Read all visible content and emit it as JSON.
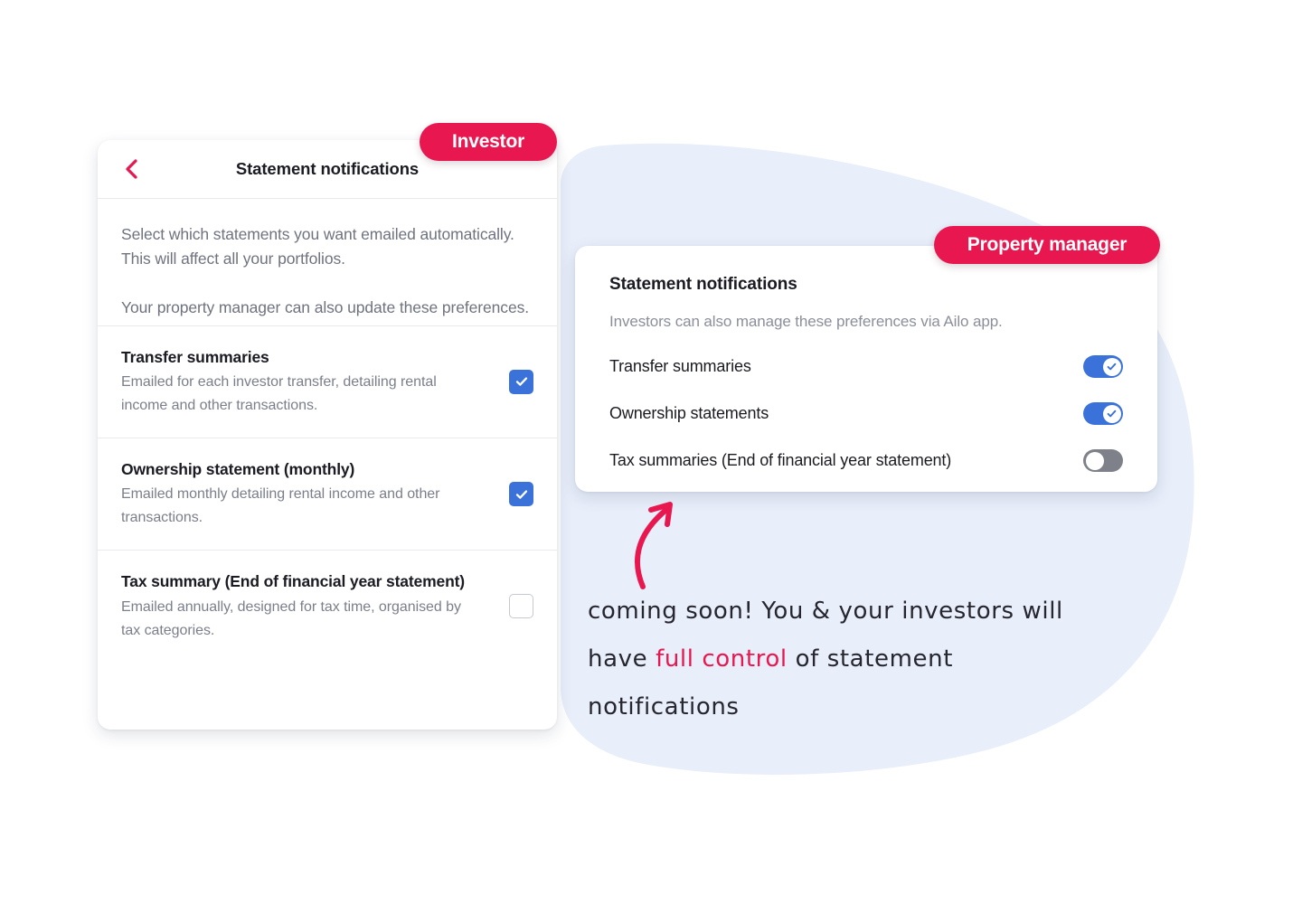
{
  "theme": {
    "accent_pink": "#e8174f",
    "accent_blue": "#3b72d9",
    "blob_blue": "#e8eefa",
    "toggle_off_gray": "#7e8189",
    "text_dark": "#1b1b23",
    "text_muted": "#7b7f8c"
  },
  "badges": {
    "investor": "Investor",
    "property_manager": "Property manager"
  },
  "investor_card": {
    "back_icon": "chevron-left-icon",
    "title": "Statement notifications",
    "intro": [
      "Select which statements you want emailed automatically. This will affect all your portfolios.",
      "Your property manager can also update these preferences."
    ],
    "items": [
      {
        "title": "Transfer summaries",
        "description": "Emailed for each investor transfer, detailing rental income and other transactions.",
        "checked": true
      },
      {
        "title": "Ownership statement (monthly)",
        "description": "Emailed monthly detailing rental income and other transactions.",
        "checked": true
      },
      {
        "title": "Tax summary (End of financial year statement)",
        "description": "Emailed annually, designed for tax time, organised by tax categories.",
        "checked": false
      }
    ]
  },
  "pm_card": {
    "title": "Statement notifications",
    "subtitle": "Investors can also manage these preferences via Ailo app.",
    "rows": [
      {
        "label": "Transfer summaries",
        "on": true
      },
      {
        "label": "Ownership statements",
        "on": true
      },
      {
        "label": "Tax summaries (End of financial year statement)",
        "on": false
      }
    ]
  },
  "annotation": {
    "arrow_icon": "curved-arrow-icon",
    "line1_before": "coming soon! You & your investors will",
    "line2_before": "have ",
    "line2_highlight": "full control",
    "line2_after": " of statement",
    "line3": "notifications"
  }
}
